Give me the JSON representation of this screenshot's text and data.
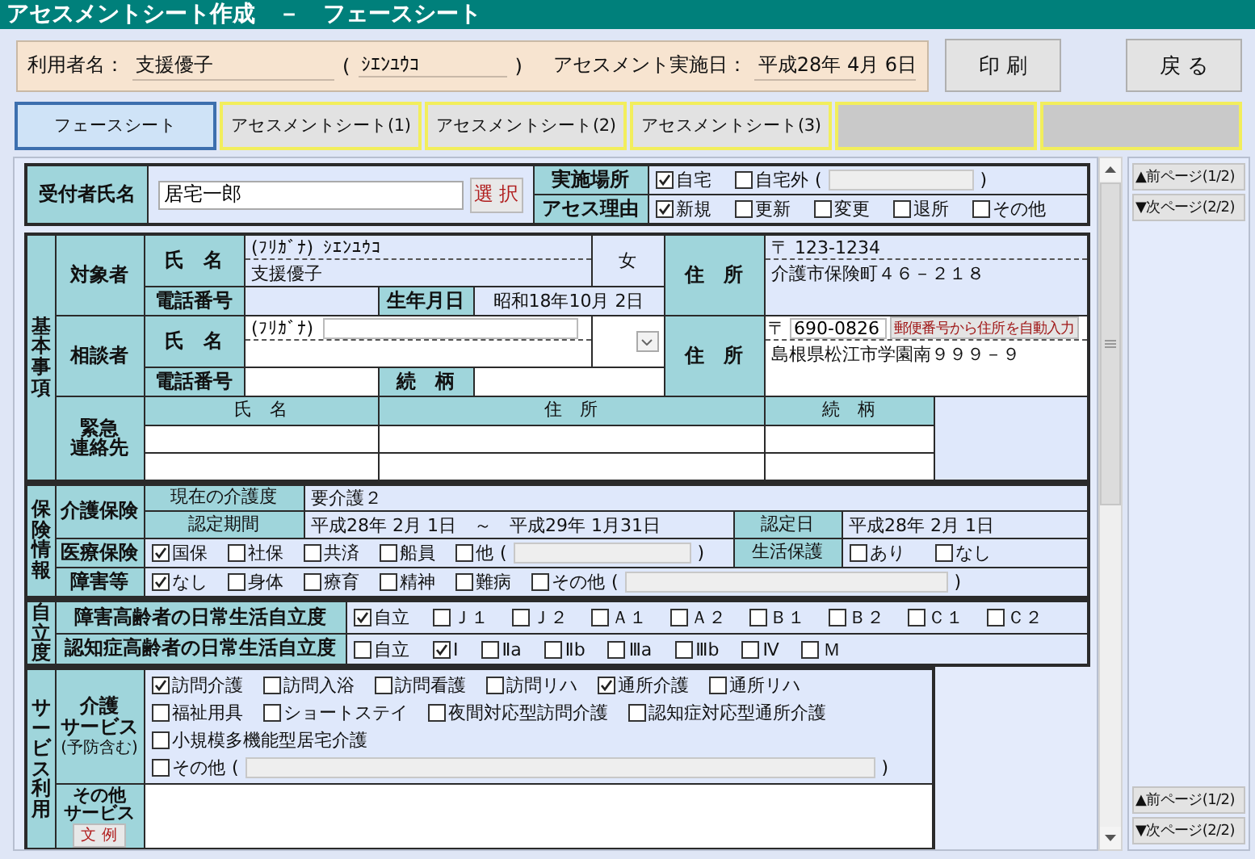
{
  "title": "アセスメントシート作成　－　フェースシート",
  "header": {
    "user_label": "利用者名：",
    "user_name": "支援優子",
    "kana_open": "(",
    "kana": "ｼｴﾝﾕｳｺ",
    "kana_close": ")",
    "date_label": "アセスメント実施日：",
    "date": "平成28年 4月 6日"
  },
  "buttons": [
    "印 刷",
    "戻 る"
  ],
  "tabs": [
    {
      "label": "フェースシート",
      "selected": true,
      "disabled": false
    },
    {
      "label": "アセスメントシート(1)",
      "selected": false,
      "disabled": false
    },
    {
      "label": "アセスメントシート(2)",
      "selected": false,
      "disabled": false
    },
    {
      "label": "アセスメントシート(3)",
      "selected": false,
      "disabled": false
    },
    {
      "selected": false,
      "disabled": true
    },
    {
      "selected": false,
      "disabled": true
    }
  ],
  "reception": {
    "label": "受付者氏名",
    "value": "居宅一郎",
    "select_button": "選 択",
    "place": {
      "label": "実施場所",
      "options": [
        {
          "kind": "check",
          "label": "自宅",
          "checked": true
        },
        {
          "kind": "check_field",
          "label": "自宅外",
          "checked": false,
          "open": "(",
          "close": ")"
        }
      ]
    },
    "reason": {
      "label": "アセス理由",
      "options": [
        {
          "kind": "check",
          "label": "新規",
          "checked": true
        },
        {
          "kind": "check",
          "label": "更新",
          "checked": false
        },
        {
          "kind": "check",
          "label": "変更",
          "checked": false
        },
        {
          "kind": "check",
          "label": "退所",
          "checked": false
        },
        {
          "kind": "check",
          "label": "その他",
          "checked": false
        }
      ]
    }
  },
  "basic": {
    "label": "基本事項",
    "subject": {
      "label": "対象者",
      "name_label": "氏　名",
      "furigana_label": "(ﾌﾘｶﾞﾅ)",
      "furigana": "ｼｴﾝﾕｳｺ",
      "name": "支援優子",
      "sex": "女",
      "address_label": "住　所",
      "postal": "〒 123-1234",
      "address": "介護市保険町４６－２１８",
      "phone_label": "電話番号",
      "birth_label": "生年月日",
      "birth": "昭和18年10月 2日"
    },
    "consultant": {
      "label": "相談者",
      "name_label": "氏　名",
      "furigana_label": "(ﾌﾘｶﾞﾅ)",
      "address_label": "住　所",
      "postal_mark": "〒",
      "postal": "690-0826",
      "auto_button": "郵便番号から住所を自動入力",
      "address": "島根県松江市学園南９９９－９",
      "phone_label": "電話番号",
      "relation_label": "続　柄"
    },
    "emergency": {
      "label_lines": [
        "緊急",
        "連絡先"
      ],
      "columns": [
        "氏　名",
        "住　所",
        "続　柄"
      ]
    }
  },
  "insurance": {
    "label": "保険情報",
    "care": {
      "label": "介護保険",
      "level_label": "現在の介護度",
      "level": "要介護２",
      "period_label": "認定期間",
      "period": "平成28年 2月 1日　～　平成29年 1月31日",
      "cert_label": "認定日",
      "cert": "平成28年 2月 1日"
    },
    "medical": {
      "label": "医療保険",
      "options": [
        {
          "kind": "check",
          "label": "国保",
          "checked": true
        },
        {
          "kind": "check",
          "label": "社保",
          "checked": false
        },
        {
          "kind": "check",
          "label": "共済",
          "checked": false
        },
        {
          "kind": "check",
          "label": "船員",
          "checked": false
        },
        {
          "kind": "check_field",
          "label": "他",
          "checked": false,
          "open": "(",
          "close": ")"
        }
      ],
      "welfare_label": "生活保護",
      "welfare": [
        {
          "kind": "check",
          "label": "あり",
          "checked": false
        },
        {
          "kind": "check",
          "label": "なし",
          "checked": false
        }
      ]
    },
    "disability": {
      "label": "障害等",
      "options": [
        {
          "kind": "check",
          "label": "なし",
          "checked": true
        },
        {
          "kind": "check",
          "label": "身体",
          "checked": false
        },
        {
          "kind": "check",
          "label": "療育",
          "checked": false
        },
        {
          "kind": "check",
          "label": "精神",
          "checked": false
        },
        {
          "kind": "check",
          "label": "難病",
          "checked": false
        },
        {
          "kind": "check_field",
          "label": "その他",
          "checked": false,
          "open": "(",
          "close": ")"
        }
      ]
    }
  },
  "independence": {
    "label": "自立度",
    "rows": [
      {
        "label": "障害高齢者の日常生活自立度",
        "options": [
          {
            "kind": "check",
            "label": "自立",
            "checked": true
          },
          {
            "kind": "check",
            "label": "Ｊ１",
            "checked": false
          },
          {
            "kind": "check",
            "label": "Ｊ２",
            "checked": false
          },
          {
            "kind": "check",
            "label": "Ａ１",
            "checked": false
          },
          {
            "kind": "check",
            "label": "Ａ２",
            "checked": false
          },
          {
            "kind": "check",
            "label": "Ｂ１",
            "checked": false
          },
          {
            "kind": "check",
            "label": "Ｂ２",
            "checked": false
          },
          {
            "kind": "check",
            "label": "Ｃ１",
            "checked": false
          },
          {
            "kind": "check",
            "label": "Ｃ２",
            "checked": false
          }
        ]
      },
      {
        "label": "認知症高齢者の日常生活自立度",
        "options": [
          {
            "kind": "check",
            "label": "自立",
            "checked": false
          },
          {
            "kind": "check",
            "label": "Ⅰ",
            "checked": true
          },
          {
            "kind": "check",
            "label": "Ⅱa",
            "checked": false
          },
          {
            "kind": "check",
            "label": "Ⅱb",
            "checked": false
          },
          {
            "kind": "check",
            "label": "Ⅲa",
            "checked": false
          },
          {
            "kind": "check",
            "label": "Ⅲb",
            "checked": false
          },
          {
            "kind": "check",
            "label": "Ⅳ",
            "checked": false
          },
          {
            "kind": "check",
            "label": "Ｍ",
            "checked": false
          }
        ]
      }
    ]
  },
  "service": {
    "label": "サービス利用",
    "care_label_lines": [
      "介護",
      "サービス"
    ],
    "care_note": "(予防含む)",
    "care_rows": [
      [
        {
          "kind": "check",
          "label": "訪問介護",
          "checked": true
        },
        {
          "kind": "check",
          "label": "訪問入浴",
          "checked": false
        },
        {
          "kind": "check",
          "label": "訪問看護",
          "checked": false
        },
        {
          "kind": "check",
          "label": "訪問リハ",
          "checked": false
        },
        {
          "kind": "check",
          "label": "通所介護",
          "checked": true
        },
        {
          "kind": "check",
          "label": "通所リハ",
          "checked": false
        }
      ],
      [
        {
          "kind": "check",
          "label": "福祉用具",
          "checked": false
        },
        {
          "kind": "check",
          "label": "ショートステイ",
          "checked": false
        },
        {
          "kind": "check",
          "label": "夜間対応型訪問介護",
          "checked": false
        },
        {
          "kind": "check",
          "label": "認知症対応型通所介護",
          "checked": false
        }
      ],
      [
        {
          "kind": "check",
          "label": "小規模多機能型居宅介護",
          "checked": false
        }
      ],
      [
        {
          "kind": "check_field",
          "label": "その他",
          "checked": false,
          "open": "(",
          "close": ")"
        }
      ]
    ],
    "other_label_lines": [
      "その他",
      "サービス"
    ],
    "example_button": "文 例"
  },
  "nav": {
    "top": [
      "▲前ページ(1/2)",
      "▼次ページ(2/2)"
    ],
    "bottom": [
      "▲前ページ(1/2)",
      "▼次ページ(2/2)"
    ]
  }
}
